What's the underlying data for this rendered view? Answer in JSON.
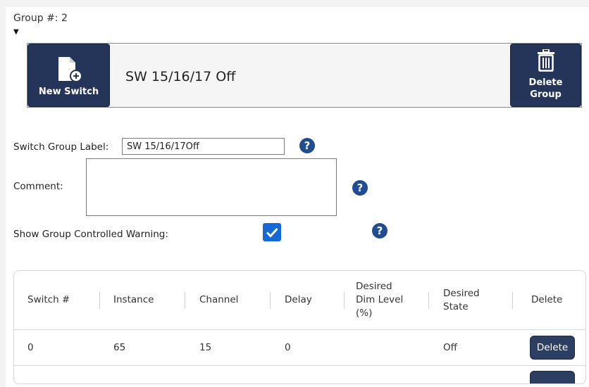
{
  "group": {
    "number_label": "Group #: 2",
    "caret": "▼",
    "title": "SW 15/16/17 Off",
    "new_switch_label": "New Switch",
    "delete_group_line1": "Delete",
    "delete_group_line2": "Group"
  },
  "form": {
    "label_label": "Switch Group Label:",
    "label_value": "SW 15/16/17Off",
    "comment_label": "Comment:",
    "comment_value": "",
    "warning_label": "Show Group Controlled Warning:",
    "warning_checked": true,
    "help_glyph": "?"
  },
  "table": {
    "headers": {
      "switch": "Switch #",
      "instance": "Instance",
      "channel": "Channel",
      "delay": "Delay",
      "dim_1": "Desired",
      "dim_2": "Dim Level",
      "dim_3": "(%)",
      "state_1": "Desired",
      "state_2": "State",
      "delete": "Delete"
    },
    "rows": [
      {
        "switch": "0",
        "instance": "65",
        "channel": "15",
        "delay": "0",
        "dim": "",
        "state": "Off",
        "delete_label": "Delete"
      }
    ]
  },
  "colors": {
    "button_dark": "#25355a",
    "help_icon": "#1f4d8f",
    "checkbox": "#1569d6"
  },
  "icons": {
    "new_switch": "new-file-icon",
    "delete_group": "trash-icon",
    "help": "question-icon",
    "checkbox": "checkmark-icon"
  }
}
